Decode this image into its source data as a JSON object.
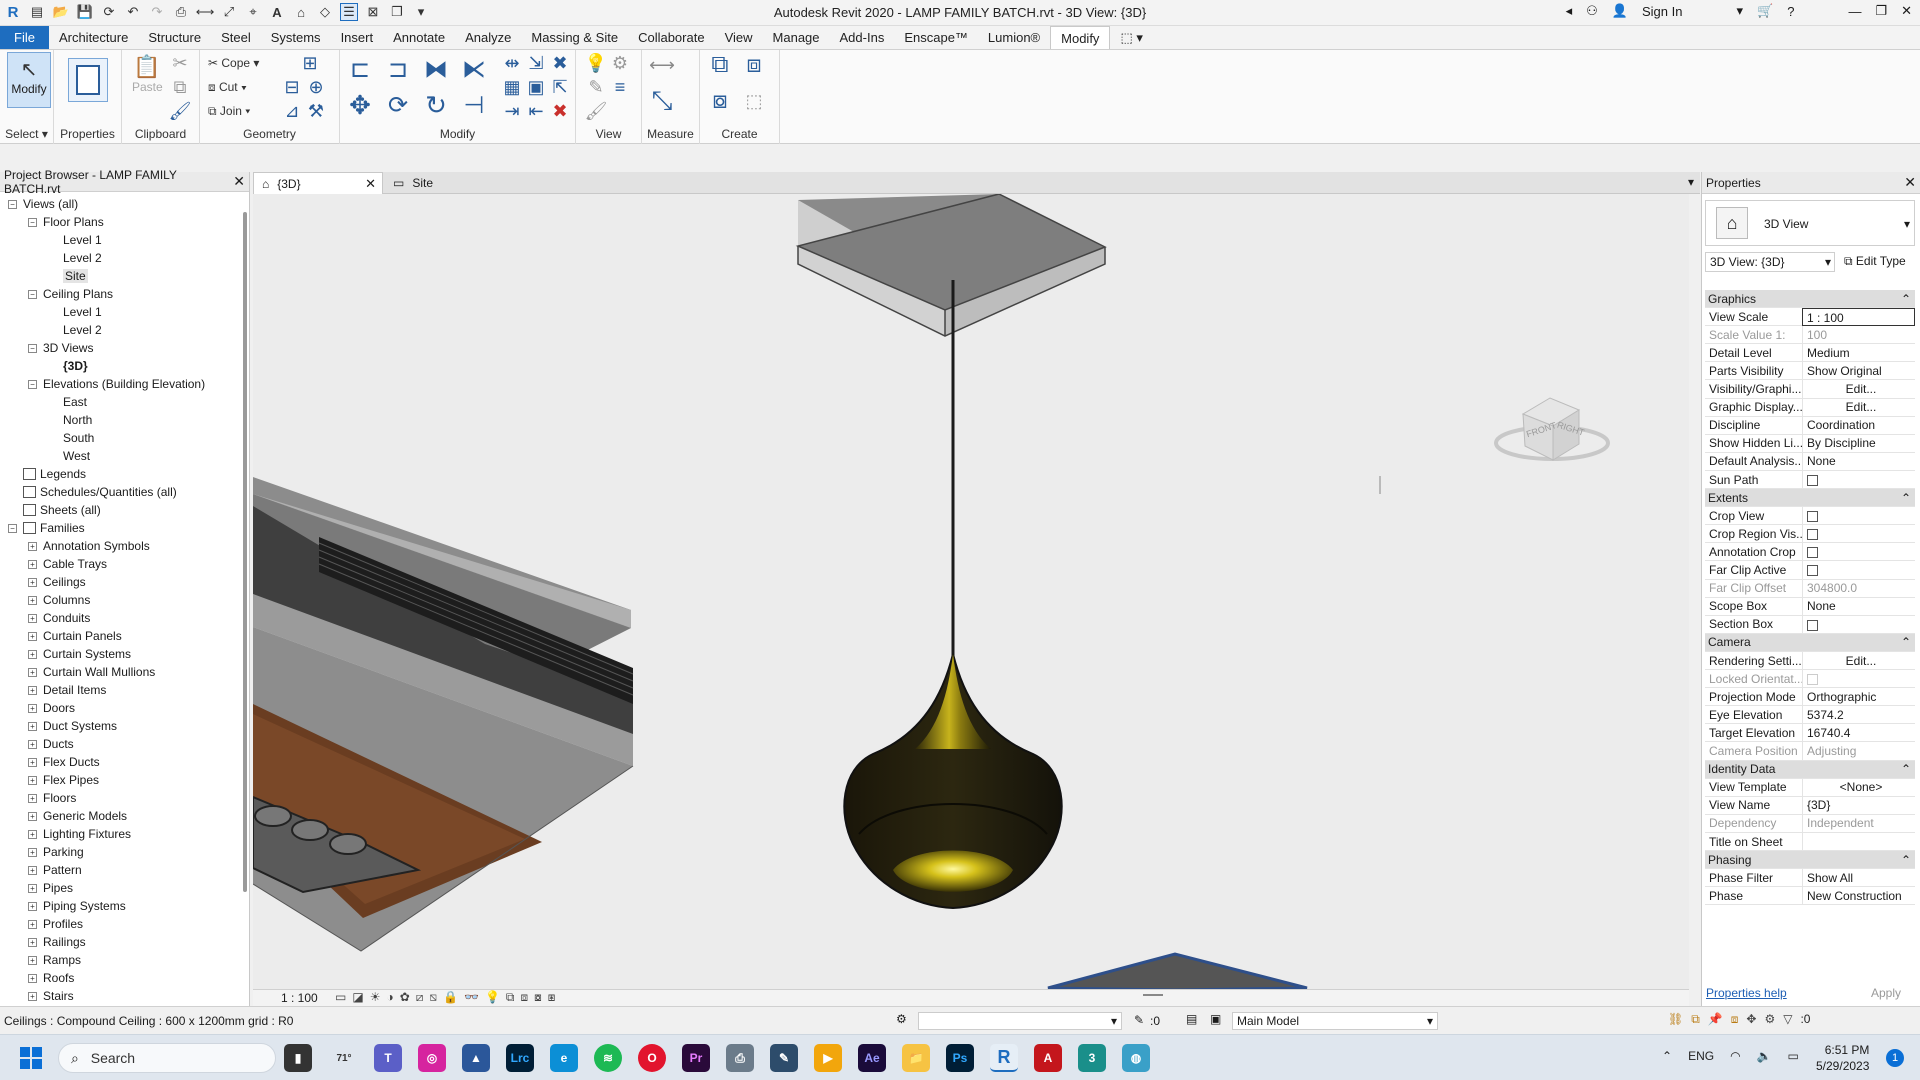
{
  "title": "Autodesk Revit 2020 - LAMP FAMILY BATCH.rvt - 3D View: {3D}",
  "sign_in": "Sign In",
  "menu": [
    "File",
    "Architecture",
    "Structure",
    "Steel",
    "Systems",
    "Insert",
    "Annotate",
    "Analyze",
    "Massing & Site",
    "Collaborate",
    "View",
    "Manage",
    "Add-Ins",
    "Enscape™",
    "Lumion®",
    "Modify"
  ],
  "ribbon": {
    "modify": "Modify",
    "select": "Select",
    "properties": "Properties",
    "paste": "Paste",
    "clipboard": "Clipboard",
    "cope": "Cope",
    "cut": "Cut",
    "join": "Join",
    "geometry": "Geometry",
    "modify_panel": "Modify",
    "view": "View",
    "measure": "Measure",
    "create": "Create"
  },
  "project_browser": {
    "title": "Project Browser - LAMP FAMILY BATCH.rvt",
    "items": [
      {
        "label": "Views (all)",
        "indent": 0,
        "toggle": "−"
      },
      {
        "label": "Floor Plans",
        "indent": 1,
        "toggle": "−"
      },
      {
        "label": "Level 1",
        "indent": 2
      },
      {
        "label": "Level 2",
        "indent": 2
      },
      {
        "label": "Site",
        "indent": 2,
        "selected": true
      },
      {
        "label": "Ceiling Plans",
        "indent": 1,
        "toggle": "−"
      },
      {
        "label": "Level 1",
        "indent": 2
      },
      {
        "label": "Level 2",
        "indent": 2
      },
      {
        "label": "3D Views",
        "indent": 1,
        "toggle": "−"
      },
      {
        "label": "{3D}",
        "indent": 2,
        "bold": true
      },
      {
        "label": "Elevations (Building Elevation)",
        "indent": 1,
        "toggle": "−"
      },
      {
        "label": "East",
        "indent": 2
      },
      {
        "label": "North",
        "indent": 2
      },
      {
        "label": "South",
        "indent": 2
      },
      {
        "label": "West",
        "indent": 2
      },
      {
        "label": "Legends",
        "indent": 0,
        "icon": true
      },
      {
        "label": "Schedules/Quantities (all)",
        "indent": 0,
        "icon": true
      },
      {
        "label": "Sheets (all)",
        "indent": 0,
        "icon": true
      },
      {
        "label": "Families",
        "indent": 0,
        "toggle": "−",
        "icon": true
      },
      {
        "label": "Annotation Symbols",
        "indent": 1,
        "toggle": "+"
      },
      {
        "label": "Cable Trays",
        "indent": 1,
        "toggle": "+"
      },
      {
        "label": "Ceilings",
        "indent": 1,
        "toggle": "+"
      },
      {
        "label": "Columns",
        "indent": 1,
        "toggle": "+"
      },
      {
        "label": "Conduits",
        "indent": 1,
        "toggle": "+"
      },
      {
        "label": "Curtain Panels",
        "indent": 1,
        "toggle": "+"
      },
      {
        "label": "Curtain Systems",
        "indent": 1,
        "toggle": "+"
      },
      {
        "label": "Curtain Wall Mullions",
        "indent": 1,
        "toggle": "+"
      },
      {
        "label": "Detail Items",
        "indent": 1,
        "toggle": "+"
      },
      {
        "label": "Doors",
        "indent": 1,
        "toggle": "+"
      },
      {
        "label": "Duct Systems",
        "indent": 1,
        "toggle": "+"
      },
      {
        "label": "Ducts",
        "indent": 1,
        "toggle": "+"
      },
      {
        "label": "Flex Ducts",
        "indent": 1,
        "toggle": "+"
      },
      {
        "label": "Flex Pipes",
        "indent": 1,
        "toggle": "+"
      },
      {
        "label": "Floors",
        "indent": 1,
        "toggle": "+"
      },
      {
        "label": "Generic Models",
        "indent": 1,
        "toggle": "+"
      },
      {
        "label": "Lighting Fixtures",
        "indent": 1,
        "toggle": "+"
      },
      {
        "label": "Parking",
        "indent": 1,
        "toggle": "+"
      },
      {
        "label": "Pattern",
        "indent": 1,
        "toggle": "+"
      },
      {
        "label": "Pipes",
        "indent": 1,
        "toggle": "+"
      },
      {
        "label": "Piping Systems",
        "indent": 1,
        "toggle": "+"
      },
      {
        "label": "Profiles",
        "indent": 1,
        "toggle": "+"
      },
      {
        "label": "Railings",
        "indent": 1,
        "toggle": "+"
      },
      {
        "label": "Ramps",
        "indent": 1,
        "toggle": "+"
      },
      {
        "label": "Roofs",
        "indent": 1,
        "toggle": "+"
      },
      {
        "label": "Stairs",
        "indent": 1,
        "toggle": "+"
      }
    ]
  },
  "tabs": [
    {
      "label": "{3D}",
      "active": true
    },
    {
      "label": "Site"
    }
  ],
  "viewcube": {
    "front": "FRONT",
    "right": "RIGHT"
  },
  "view_scale": "1 : 100",
  "properties": {
    "title": "Properties",
    "type_name": "3D View",
    "selector": "3D View: {3D}",
    "edit_type": "Edit Type",
    "rows": [
      {
        "group": "Graphics"
      },
      {
        "k": "View Scale",
        "v": "1 : 100"
      },
      {
        "k": "Scale Value    1:",
        "v": "100",
        "dim": true
      },
      {
        "k": "Detail Level",
        "v": "Medium"
      },
      {
        "k": "Parts Visibility",
        "v": "Show Original"
      },
      {
        "k": "Visibility/Graphi...",
        "v": "Edit...",
        "btn": true
      },
      {
        "k": "Graphic Display...",
        "v": "Edit...",
        "btn": true
      },
      {
        "k": "Discipline",
        "v": "Coordination"
      },
      {
        "k": "Show Hidden Li...",
        "v": "By Discipline"
      },
      {
        "k": "Default Analysis...",
        "v": "None"
      },
      {
        "k": "Sun Path",
        "cb": true
      },
      {
        "group": "Extents"
      },
      {
        "k": "Crop View",
        "cb": true
      },
      {
        "k": "Crop Region Vis...",
        "cb": true
      },
      {
        "k": "Annotation Crop",
        "cb": true
      },
      {
        "k": "Far Clip Active",
        "cb": true
      },
      {
        "k": "Far Clip Offset",
        "v": "304800.0",
        "dim": true
      },
      {
        "k": "Scope Box",
        "v": "None"
      },
      {
        "k": "Section Box",
        "cb": true
      },
      {
        "group": "Camera"
      },
      {
        "k": "Rendering Setti...",
        "v": "Edit...",
        "btn": true
      },
      {
        "k": "Locked Orientat...",
        "cb": true,
        "dim": true
      },
      {
        "k": "Projection Mode",
        "v": "Orthographic"
      },
      {
        "k": "Eye Elevation",
        "v": "5374.2"
      },
      {
        "k": "Target Elevation",
        "v": "16740.4"
      },
      {
        "k": "Camera Position",
        "v": "Adjusting",
        "dim": true
      },
      {
        "group": "Identity Data"
      },
      {
        "k": "View Template",
        "v": "<None>",
        "btn": true
      },
      {
        "k": "View Name",
        "v": "{3D}"
      },
      {
        "k": "Dependency",
        "v": "Independent",
        "dim": true
      },
      {
        "k": "Title on Sheet",
        "v": ""
      },
      {
        "group": "Phasing"
      },
      {
        "k": "Phase Filter",
        "v": "Show All"
      },
      {
        "k": "Phase",
        "v": "New Construction"
      }
    ],
    "help": "Properties help",
    "apply": "Apply"
  },
  "status": {
    "text": "Ceilings : Compound Ceiling : 600 x 1200mm grid : R0",
    "workset_count": ":0",
    "model": "Main Model",
    "filter_count": ":0"
  },
  "taskbar": {
    "search": "Search",
    "weather": "71°",
    "lang": "ENG",
    "time": "6:51 PM",
    "date": "5/29/2023",
    "badge": "1"
  }
}
